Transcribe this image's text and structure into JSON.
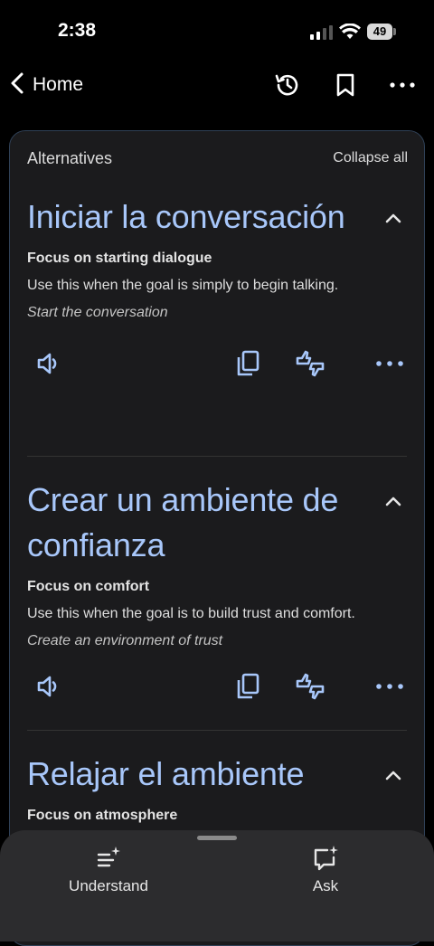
{
  "status_bar": {
    "time": "2:38",
    "battery": "49"
  },
  "nav": {
    "back_label": "Home"
  },
  "panel": {
    "title": "Alternatives",
    "collapse_all": "Collapse all"
  },
  "alternatives": [
    {
      "title": "Iniciar la conversación",
      "focus": "Focus on starting dialogue",
      "description": "Use this when the goal is simply to begin talking.",
      "translation": "Start the conversation"
    },
    {
      "title": "Crear un ambiente de confianza",
      "focus": "Focus on comfort",
      "description": "Use this when the goal is to build trust and comfort.",
      "translation": "Create an environment of trust"
    },
    {
      "title": "Relajar el ambiente",
      "focus": "Focus on atmosphere"
    }
  ],
  "bottom_tabs": [
    {
      "label": "Understand",
      "icon": "understand-sparkle-icon"
    },
    {
      "label": "Ask",
      "icon": "ask-sparkle-icon"
    }
  ],
  "colors": {
    "accent": "#a8c7fa",
    "card_bg": "#1b1b1d",
    "sheet_bg": "#2c2c2e"
  }
}
